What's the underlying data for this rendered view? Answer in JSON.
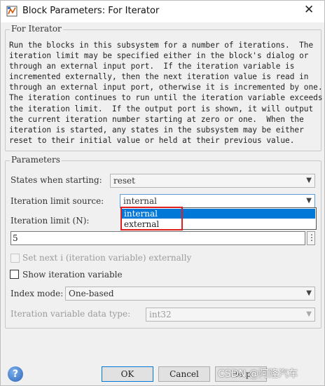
{
  "window": {
    "title": "Block Parameters: For Iterator",
    "close_glyph": "✕",
    "icon": "simulink-block-icon"
  },
  "description": {
    "legend": "For Iterator",
    "text": "Run the blocks in this subsystem for a number of iterations.  The\niteration limit may be specified either in the block's dialog or\nthrough an external input port.  If the iteration variable is\nincremented externally, then the next iteration value is read in\nthrough an external input port, otherwise it is incremented by one.\nThe iteration continues to run until the iteration variable exceeds\nthe iteration limit.  If the output port is shown, it will output\nthe current iteration number starting at zero or one.  When the\niteration is started, any states in the subsystem may be either\nreset to their initial value or held at their previous value."
  },
  "parameters": {
    "legend": "Parameters",
    "states_when_starting": {
      "label": "States when starting:",
      "value": "reset"
    },
    "iteration_limit_source": {
      "label": "Iteration limit source:",
      "value": "internal",
      "options": [
        "internal",
        "external"
      ],
      "highlighted_option": "internal"
    },
    "iteration_limit": {
      "label": "Iteration limit (N):",
      "value": "5",
      "more_button": "⋮"
    },
    "set_next_i": {
      "label": "Set next i (iteration variable) externally",
      "checked": false,
      "enabled": false
    },
    "show_iteration_variable": {
      "label": "Show iteration variable",
      "checked": false,
      "enabled": true
    },
    "index_mode": {
      "label": "Index mode:",
      "value": "One-based"
    },
    "iteration_variable_data_type": {
      "label": "Iteration variable data type:",
      "value": "int32",
      "enabled": false
    }
  },
  "footer": {
    "help": "?",
    "ok": "OK",
    "cancel": "Cancel",
    "help_btn_label": "Help",
    "watermark": "CSDN @阿隆汽车"
  },
  "colors": {
    "selection": "#0078d7",
    "annotation_box": "#e02020"
  }
}
